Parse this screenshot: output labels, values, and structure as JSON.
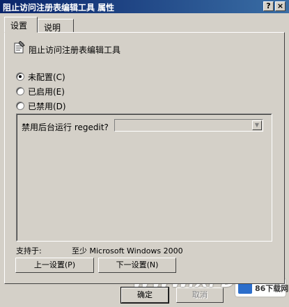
{
  "window": {
    "title": "阻止访问注册表编辑工具 属性",
    "help_button": "?",
    "close_button": "×"
  },
  "tabs": [
    {
      "label": "设置",
      "active": true
    },
    {
      "label": "说明",
      "active": false
    }
  ],
  "policy": {
    "name": "阻止访问注册表编辑工具",
    "icon": "policy-icon"
  },
  "state_options": [
    {
      "label": "未配置(C)",
      "selected": true
    },
    {
      "label": "已启用(E)",
      "selected": false
    },
    {
      "label": "已禁用(D)",
      "selected": false
    }
  ],
  "options": {
    "label": "禁用后台运行 regedit?",
    "combo_value": ""
  },
  "supported": {
    "label": "支持于:",
    "value": "至少 Microsoft Windows 2000"
  },
  "nav": {
    "prev": "上一设置(P)",
    "next": "下一设置(N)"
  },
  "footer": {
    "ok": "确定",
    "cancel": "取消"
  },
  "watermark": {
    "text": "WWW.XFDOW",
    "badge": "86下载网"
  }
}
